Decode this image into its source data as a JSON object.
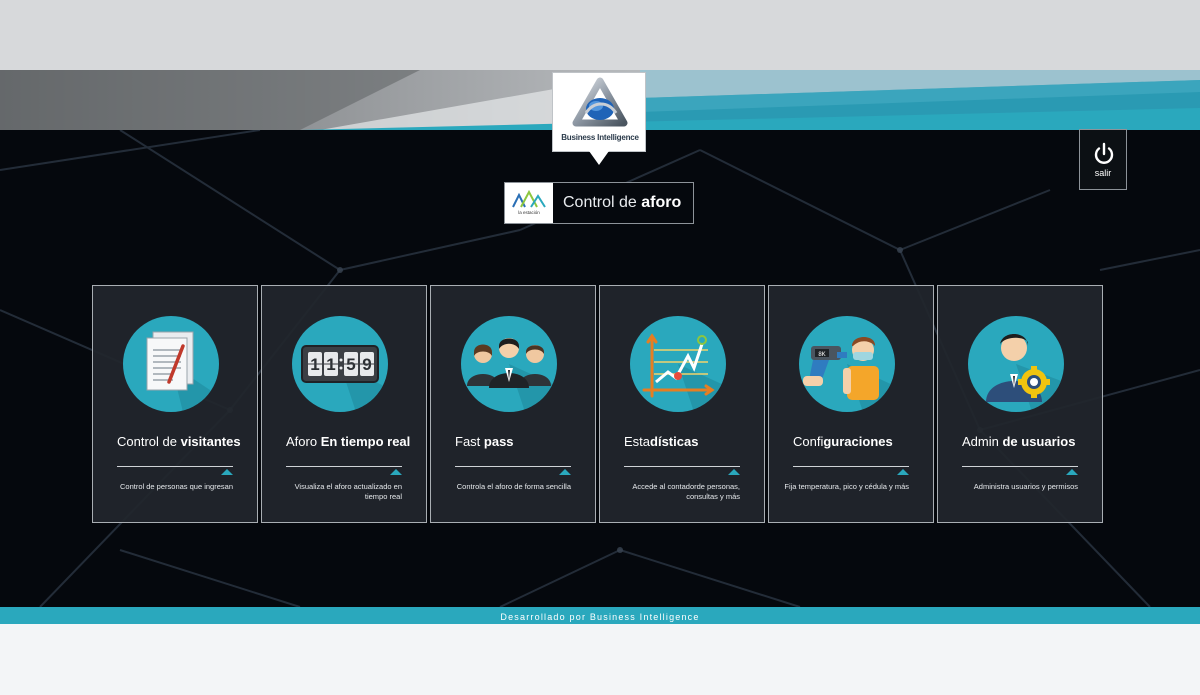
{
  "header": {
    "logo_text": "Business Intelligence",
    "brand_mark_text": "la estación"
  },
  "app_title": {
    "prefix": "Control de",
    "bold": "aforo"
  },
  "exit": {
    "label": "salir",
    "icon": "power-icon"
  },
  "cards": [
    {
      "title_plain": "Control de ",
      "title_bold": "visitantes",
      "description": "Control de personas que ingresan",
      "icon": "documents-icon"
    },
    {
      "title_plain": "Aforo ",
      "title_bold": "En tiempo real",
      "description": "Visualiza el aforo actualizado en tiempo real",
      "icon": "clock-counter-icon",
      "clock_digits": [
        "1",
        "1",
        "5",
        "9"
      ]
    },
    {
      "title_plain": "Fast ",
      "title_bold": "pass",
      "description": "Controla el aforo de forma sencilla",
      "icon": "people-group-icon"
    },
    {
      "title_plain": "Esta",
      "title_bold": "dísticas",
      "description": "Accede al contadorde personas, consultas y más",
      "icon": "chart-icon"
    },
    {
      "title_plain": "Confi",
      "title_bold": "guraciones",
      "description": "Fija temperatura, pico y cédula y más",
      "icon": "thermometer-gun-icon",
      "gun_label": "8K"
    },
    {
      "title_plain": "Admin ",
      "title_bold": "de usuarios",
      "description": "Administra usuarios y permisos",
      "icon": "user-gear-icon"
    }
  ],
  "footer": {
    "text": "Desarrollado por Business Intelligence"
  },
  "colors": {
    "accent": "#2aa8bd",
    "background": "#05080d",
    "card": "#22262c"
  }
}
